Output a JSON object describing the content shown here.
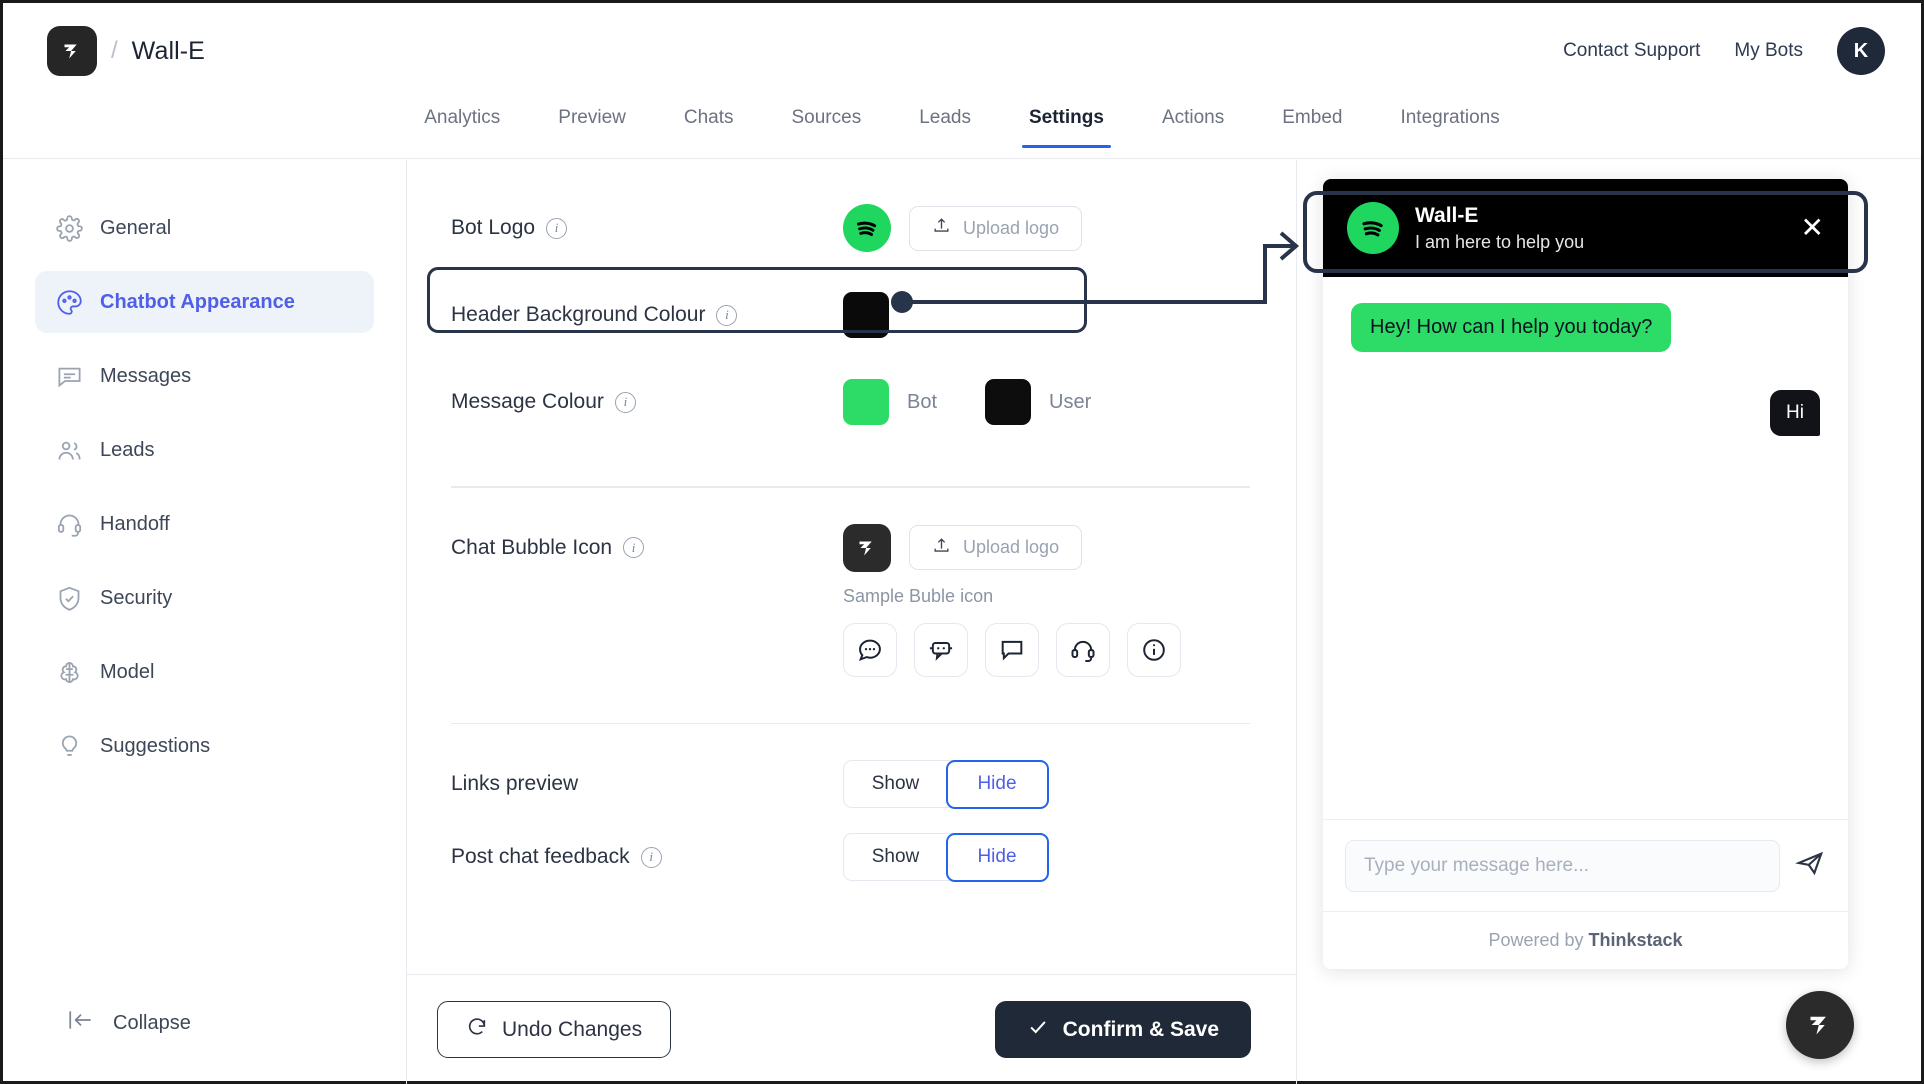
{
  "topbar": {
    "logo_icon": "thinkstack-logo-icon",
    "separator": "/",
    "bot_name": "Wall-E",
    "contact_support": "Contact Support",
    "my_bots": "My Bots",
    "avatar_initial": "K"
  },
  "tabs": [
    {
      "label": "Analytics",
      "active": false
    },
    {
      "label": "Preview",
      "active": false
    },
    {
      "label": "Chats",
      "active": false
    },
    {
      "label": "Sources",
      "active": false
    },
    {
      "label": "Leads",
      "active": false
    },
    {
      "label": "Settings",
      "active": true
    },
    {
      "label": "Actions",
      "active": false
    },
    {
      "label": "Embed",
      "active": false
    },
    {
      "label": "Integrations",
      "active": false
    }
  ],
  "sidebar": {
    "items": [
      {
        "label": "General",
        "icon": "gear-icon",
        "active": false
      },
      {
        "label": "Chatbot Appearance",
        "icon": "palette-icon",
        "active": true
      },
      {
        "label": "Messages",
        "icon": "message-icon",
        "active": false
      },
      {
        "label": "Leads",
        "icon": "users-icon",
        "active": false
      },
      {
        "label": "Handoff",
        "icon": "headset-icon",
        "active": false
      },
      {
        "label": "Security",
        "icon": "shield-check-icon",
        "active": false
      },
      {
        "label": "Model",
        "icon": "brain-icon",
        "active": false
      },
      {
        "label": "Suggestions",
        "icon": "lightbulb-icon",
        "active": false
      }
    ],
    "collapse_label": "Collapse",
    "collapse_icon": "collapse-left-icon"
  },
  "settings": {
    "bot_logo": {
      "label": "Bot Logo",
      "upload_label": "Upload logo",
      "logo_icon": "spotify-logo-icon"
    },
    "header_bg": {
      "label": "Header Background Colour",
      "color": "#0a0a0a",
      "highlighted": true
    },
    "message_colour": {
      "label": "Message Colour",
      "bot_label": "Bot",
      "bot_color": "#2ddc66",
      "user_label": "User",
      "user_color": "#0d0d0d"
    },
    "chat_bubble_icon": {
      "label": "Chat Bubble Icon",
      "upload_label": "Upload logo",
      "current_icon": "thinkstack-logo-icon",
      "sample_label": "Sample Buble icon",
      "samples": [
        "chat-dots-icon",
        "bot-face-icon",
        "speech-bubble-icon",
        "headset-icon",
        "info-circle-icon"
      ]
    },
    "links_preview": {
      "label": "Links preview",
      "options": [
        "Show",
        "Hide"
      ],
      "selected": "Hide"
    },
    "post_chat_feedback": {
      "label": "Post chat feedback",
      "options": [
        "Show",
        "Hide"
      ],
      "selected": "Hide"
    },
    "undo_label": "Undo Changes",
    "save_label": "Confirm & Save"
  },
  "chat_preview": {
    "header": {
      "bot_name": "Wall-E",
      "subtitle": "I am here to help you",
      "avatar_icon": "spotify-logo-icon",
      "close_icon": "close-icon",
      "bg_color": "#000000"
    },
    "messages": [
      {
        "from": "bot",
        "text": "Hey! How can I help you today?",
        "color": "#2ddc66"
      },
      {
        "from": "user",
        "text": "Hi",
        "color": "#111318"
      }
    ],
    "input_placeholder": "Type your message here...",
    "send_icon": "send-icon",
    "footer_prefix": "Powered by",
    "footer_brand": "Thinkstack"
  },
  "colors": {
    "accent_blue": "#2563eb",
    "active_nav": "#4f5fe8",
    "dark": "#1f2937",
    "brand_green": "#2ddc66"
  }
}
